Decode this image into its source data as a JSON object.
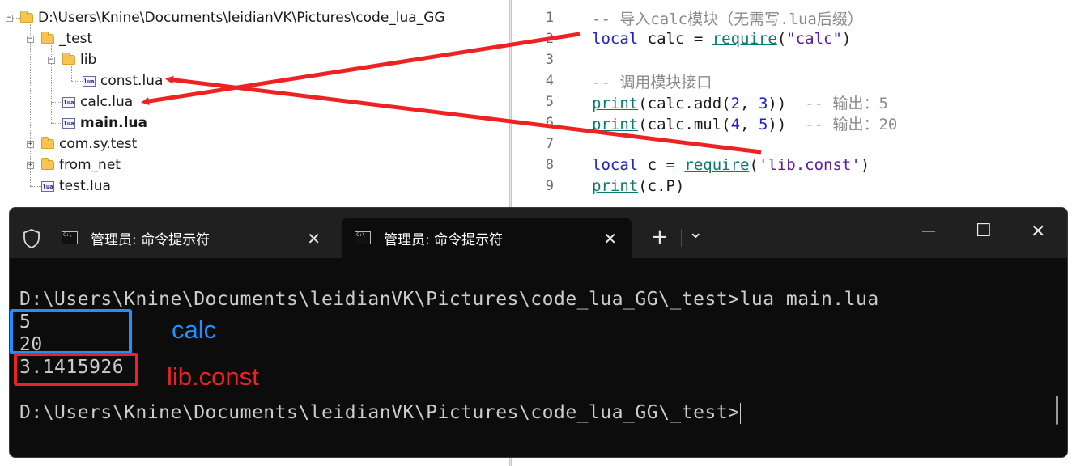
{
  "tree": {
    "root": "D:\\Users\\Knine\\Documents\\leidianVK\\Pictures\\code_lua_GG",
    "test_folder": "_test",
    "lib_folder": "lib",
    "const_file": "const.lua",
    "calc_file": "calc.lua",
    "main_file": "main.lua",
    "com_folder": "com.sy.test",
    "fromnet_folder": "from_net",
    "test_file": "test.lua",
    "lua_badge": "lua",
    "expand_minus": "−",
    "expand_plus": "+"
  },
  "editor": {
    "line_numbers": [
      "1",
      "2",
      "3",
      "4",
      "5",
      "6",
      "7",
      "8",
      "9"
    ],
    "l1_comment": "-- 导入calc模块（无需写.lua后缀）",
    "l2_local": "local",
    "l2_var": " calc = ",
    "l2_fn": "require",
    "l2_open": "(",
    "l2_str": "\"calc\"",
    "l2_close": ")",
    "l4_comment": "-- 调用模块接口",
    "l5_fn": "print",
    "l5_a": "(calc.add(",
    "l5_n1": "2",
    "l5_b": ", ",
    "l5_n2": "3",
    "l5_c": "))  ",
    "l5_comment": "-- 输出：5",
    "l6_fn": "print",
    "l6_a": "(calc.mul(",
    "l6_n1": "4",
    "l6_b": ", ",
    "l6_n2": "5",
    "l6_c": "))  ",
    "l6_comment": "-- 输出：20",
    "l8_local": "local",
    "l8_var": " c = ",
    "l8_fn": "require",
    "l8_open": "(",
    "l8_str": "'lib.const'",
    "l8_close": ")",
    "l9_fn": "print",
    "l9_rest": "(c.P)"
  },
  "terminal": {
    "tab1_title": "管理员: 命令提示符",
    "tab2_title": "管理员: 命令提示符",
    "close_glyph": "✕",
    "new_tab_glyph": "+",
    "dropdown_glyph": "⌄",
    "minimize_glyph": "—",
    "maximize_glyph": "☐",
    "window_close_glyph": "✕",
    "prompt_command": "D:\\Users\\Knine\\Documents\\leidianVK\\Pictures\\code_lua_GG\\_test>lua main.lua",
    "out1": "5",
    "out2": "20",
    "out3": "3.1415926",
    "prompt_final": "D:\\Users\\Knine\\Documents\\leidianVK\\Pictures\\code_lua_GG\\_test>"
  },
  "annotations": {
    "calc_label": "calc",
    "const_label": "lib.const",
    "calc_color": "#1e90ff",
    "const_color": "#ee2222"
  },
  "colors": {
    "keyword": "#1f1fcf",
    "function": "#0b7a6e",
    "string": "#5c1a9e",
    "comment": "#8a8a8a",
    "terminal_bg": "#0c0c0c",
    "terminal_text": "#cccccc",
    "arrow": "#ee2222"
  }
}
